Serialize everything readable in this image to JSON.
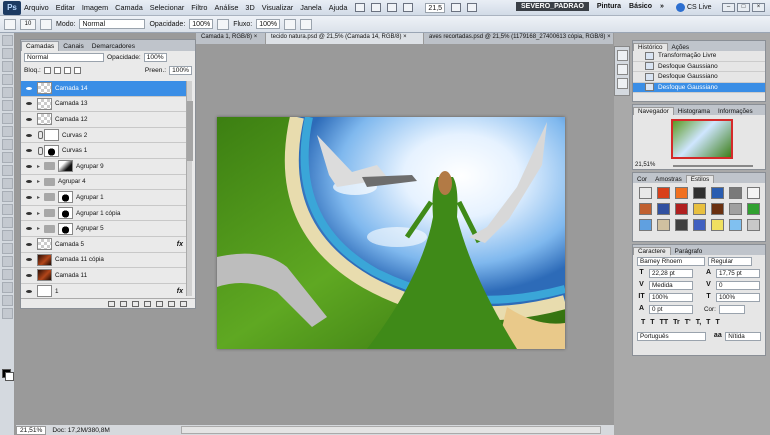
{
  "app": {
    "logo": "Ps",
    "menu": [
      "Arquivo",
      "Editar",
      "Imagem",
      "Camada",
      "Selecionar",
      "Filtro",
      "Análise",
      "3D",
      "Visualizar",
      "Janela",
      "Ajuda"
    ],
    "zoom": "21,5",
    "workspace_active": "SEVERO_PADRAO",
    "workspaces": [
      "Pintura",
      "Básico"
    ],
    "more": "»",
    "cs_live": "CS Live"
  },
  "options_bar": {
    "mode_label": "Modo:",
    "mode_value": "Normal",
    "opacity_label": "Opacidade:",
    "opacity_value": "100%",
    "flow_label": "Fluxo:",
    "flow_value": "100%",
    "brush_size": "10"
  },
  "layers_panel": {
    "tabs": [
      "Camadas",
      "Canais",
      "Demarcadores"
    ],
    "blend_mode": "Normal",
    "opacity_label": "Opacidade:",
    "opacity_value": "100%",
    "lock_label": "Bloq.:",
    "fill_label": "Preen.:",
    "fill_value": "100%",
    "layers": [
      {
        "name": "Camada 14",
        "selected": true,
        "thumb": "checker",
        "fx": false
      },
      {
        "name": "Camada 13",
        "selected": false,
        "thumb": "checker",
        "fx": false
      },
      {
        "name": "Camada 12",
        "selected": false,
        "thumb": "checker",
        "fx": false
      },
      {
        "name": "Curvas 2",
        "selected": false,
        "thumb": "white",
        "fx": false
      },
      {
        "name": "Curvas 1",
        "selected": false,
        "thumb": "blob",
        "fx": false
      },
      {
        "name": "Agrupar 9",
        "selected": false,
        "thumb": "grad",
        "fx": false
      },
      {
        "name": "Agrupar 4",
        "selected": false,
        "thumb": "none",
        "fx": false
      },
      {
        "name": "Agrupar 1",
        "selected": false,
        "thumb": "blob",
        "fx": false
      },
      {
        "name": "Agrupar 1 cópia",
        "selected": false,
        "thumb": "blob",
        "fx": false
      },
      {
        "name": "Agrupar 5",
        "selected": false,
        "thumb": "blob",
        "fx": false
      },
      {
        "name": "Camada 5",
        "selected": false,
        "thumb": "checker",
        "fx": true
      },
      {
        "name": "Camada 11 cópia",
        "selected": false,
        "thumb": "scene",
        "fx": false
      },
      {
        "name": "Camada 11",
        "selected": false,
        "thumb": "scene",
        "fx": false
      },
      {
        "name": "1",
        "selected": false,
        "thumb": "white",
        "fx": true
      }
    ]
  },
  "documents": {
    "tabs": [
      {
        "label": "Camada 1, RGB/8) ×",
        "active": false
      },
      {
        "label": "tecido natura.psd @ 21,5% (Camada 14, RGB/8) ×",
        "active": true
      },
      {
        "label": "aves recortadas.psd @ 21,5% (1179168_27400613 cópia, RGB/8) ×",
        "active": false
      }
    ]
  },
  "status": {
    "zoom": "21,51%",
    "doc_info": "Doc: 17,2M/380,8M"
  },
  "history_panel": {
    "tabs": [
      "Histórico",
      "Ações"
    ],
    "items": [
      {
        "label": "Transformação Livre",
        "current": false
      },
      {
        "label": "Desfoque Gaussiano",
        "current": false
      },
      {
        "label": "Desfoque Gaussiano",
        "current": false
      },
      {
        "label": "Desfoque Gaussiano",
        "current": true
      }
    ]
  },
  "navigator_panel": {
    "tabs": [
      "Navegador",
      "Histograma",
      "Informações"
    ],
    "zoom": "21,51%"
  },
  "styles_panel": {
    "tabs": [
      "Cor",
      "Amostras",
      "Estilos"
    ],
    "swatches": [
      "#e8e8e8",
      "#d8401a",
      "#f07020",
      "#303030",
      "#2a5db0",
      "#7a7a7a",
      "#f4f4f4",
      "#c06030",
      "#3050a0",
      "#b02020",
      "#e8c040",
      "#6a3010",
      "#a0a0a0",
      "#30a030",
      "#60a0e0",
      "#d0c0a0",
      "#404040",
      "#4060c0",
      "#f0e060",
      "#80c0f0",
      "#c8c8c8"
    ]
  },
  "character_panel": {
    "tabs": [
      "Caractere",
      "Parágrafo"
    ],
    "font_family": "Barney Rhoem",
    "font_style": "Regular",
    "font_size": "22,28 pt",
    "leading": "17,75 pt",
    "kerning": "Medida",
    "tracking": "0",
    "vscale": "100%",
    "hscale": "100%",
    "baseline": "0 pt",
    "color_label": "Cor:",
    "style_buttons": [
      "T",
      "T",
      "TT",
      "Tr",
      "T'",
      "T,",
      "T",
      "T"
    ],
    "language": "Português",
    "antialias": "Nítida"
  }
}
